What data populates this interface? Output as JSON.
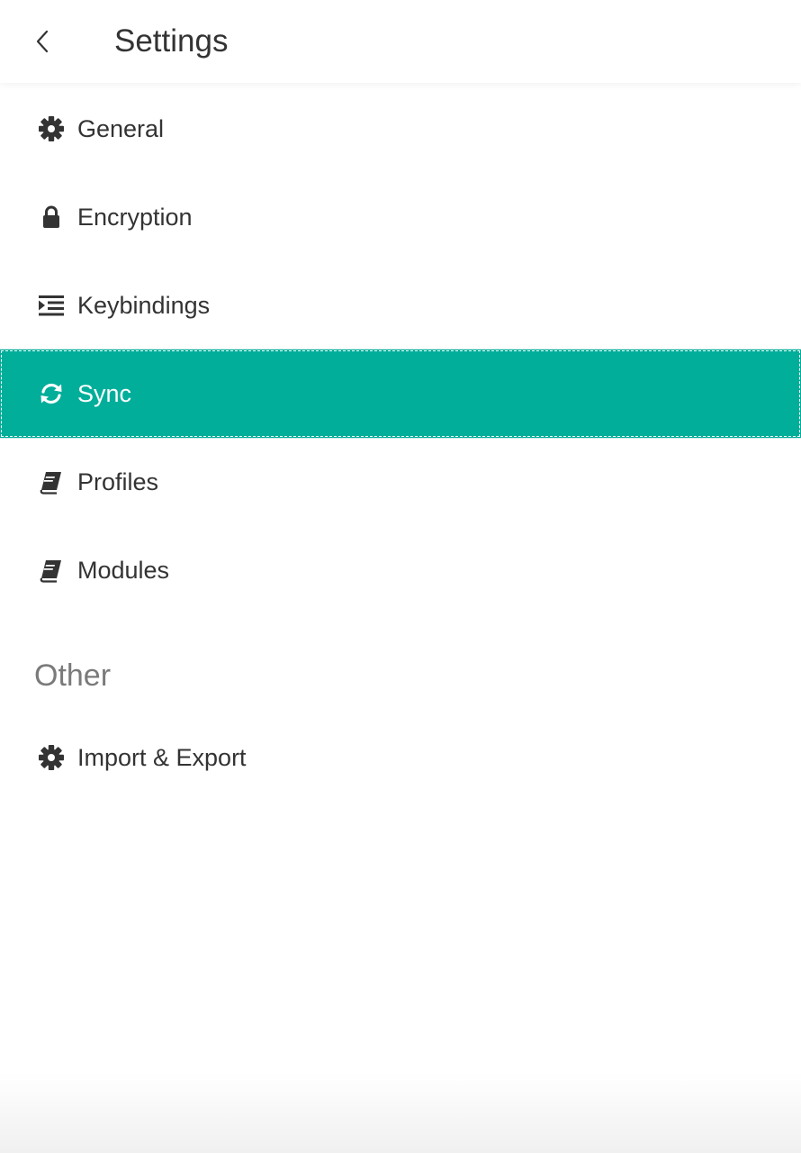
{
  "header": {
    "back_icon": "chevron-left-icon",
    "title": "Settings"
  },
  "menu": {
    "items": [
      {
        "label": "General",
        "icon": "gear-icon"
      },
      {
        "label": "Encryption",
        "icon": "lock-icon"
      },
      {
        "label": "Keybindings",
        "icon": "indent-list-icon"
      },
      {
        "label": "Sync",
        "icon": "sync-icon",
        "selected": true
      },
      {
        "label": "Profiles",
        "icon": "book-icon"
      },
      {
        "label": "Modules",
        "icon": "book-icon"
      }
    ]
  },
  "other": {
    "heading": "Other",
    "items": [
      {
        "label": "Import & Export",
        "icon": "gear-icon"
      }
    ]
  },
  "colors": {
    "accent": "#00ae9a",
    "text": "#333333",
    "section_heading": "#7a7a7a"
  }
}
